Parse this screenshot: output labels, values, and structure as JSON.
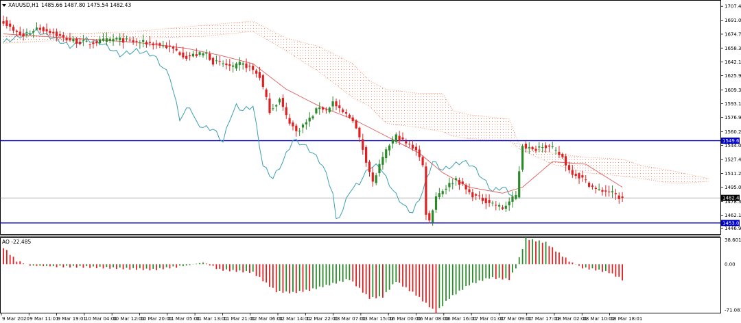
{
  "header": {
    "symbol": "XAUUSD,H1",
    "ohlc": "1485.66 1487.80 1475.54 1482.43",
    "ao_label": "AO -22.485"
  },
  "colors": {
    "bull": "#2a8a2a",
    "bear": "#e02020",
    "ma": "#e05a5a",
    "chikou": "#3a9fb0",
    "cloud": "#f08a6a",
    "level_line": "#0000cc",
    "price_line": "#808080"
  },
  "chart_data": [
    {
      "type": "candlestick",
      "title": "",
      "ylim": [
        1440,
        1714
      ],
      "y_ticks": [
        "1707.40",
        "1691.05",
        "1674.70",
        "1658.35",
        "1642.15",
        "1625.95",
        "1609.30",
        "1593.10",
        "1576.90",
        "1560.25",
        "1544.05",
        "1527.40",
        "1511.20",
        "1495.00",
        "1478.35",
        "1462.15",
        "1446.95"
      ],
      "x_ticks": [
        "9 Mar 2020",
        "9 Mar 11:01",
        "9 Mar 19:01",
        "10 Mar 04:01",
        "10 Mar 12:01",
        "10 Mar 20:01",
        "11 Mar 05:01",
        "11 Mar 13:01",
        "11 Mar 21:01",
        "12 Mar 06:01",
        "12 Mar 14:01",
        "12 Mar 22:01",
        "13 Mar 07:01",
        "13 Mar 15:01",
        "16 Mar 00:01",
        "16 Mar 08:01",
        "16 Mar 16:01",
        "17 Mar 01:01",
        "17 Mar 09:01",
        "17 Mar 17:01",
        "18 Mar 02:01",
        "18 Mar 10:01",
        "18 Mar 18:01"
      ],
      "horizontal_levels": [
        {
          "label": "1549.63",
          "value": 1549.63
        },
        {
          "label": "1453.02",
          "value": 1453.02
        }
      ],
      "current_price": {
        "label": "1482.43",
        "value": 1482.43
      },
      "anchors": [
        [
          0,
          1690
        ],
        [
          3,
          1678
        ],
        [
          6,
          1672
        ],
        [
          10,
          1682
        ],
        [
          14,
          1678
        ],
        [
          18,
          1670
        ],
        [
          22,
          1666
        ],
        [
          26,
          1664
        ],
        [
          30,
          1667
        ],
        [
          34,
          1669
        ],
        [
          38,
          1666
        ],
        [
          42,
          1665
        ],
        [
          46,
          1663
        ],
        [
          49,
          1660
        ],
        [
          52,
          1655
        ],
        [
          55,
          1648
        ],
        [
          57,
          1650
        ],
        [
          61,
          1652
        ],
        [
          63,
          1642
        ],
        [
          66,
          1640
        ],
        [
          69,
          1635
        ],
        [
          71,
          1640
        ],
        [
          74,
          1636
        ],
        [
          77,
          1625
        ],
        [
          80,
          1585
        ],
        [
          83,
          1598
        ],
        [
          85,
          1578
        ],
        [
          88,
          1560
        ],
        [
          92,
          1575
        ],
        [
          95,
          1590
        ],
        [
          97,
          1585
        ],
        [
          99,
          1595
        ],
        [
          101,
          1585
        ],
        [
          105,
          1575
        ],
        [
          108,
          1540
        ],
        [
          111,
          1500
        ],
        [
          113,
          1520
        ],
        [
          116,
          1545
        ],
        [
          118,
          1555
        ],
        [
          121,
          1546
        ],
        [
          124,
          1540
        ],
        [
          126,
          1520
        ],
        [
          127,
          1465
        ],
        [
          128,
          1455
        ],
        [
          130,
          1485
        ],
        [
          133,
          1495
        ],
        [
          136,
          1505
        ],
        [
          140,
          1488
        ],
        [
          143,
          1482
        ],
        [
          147,
          1476
        ],
        [
          150,
          1470
        ],
        [
          152,
          1478
        ],
        [
          154,
          1485
        ],
        [
          156,
          1545
        ],
        [
          159,
          1538
        ],
        [
          162,
          1545
        ],
        [
          165,
          1540
        ],
        [
          168,
          1530
        ],
        [
          170,
          1515
        ],
        [
          174,
          1505
        ],
        [
          178,
          1492
        ],
        [
          182,
          1490
        ],
        [
          185,
          1483
        ],
        [
          186,
          1482.43
        ]
      ],
      "ma_anchors": [
        [
          0,
          1675
        ],
        [
          20,
          1670
        ],
        [
          40,
          1665
        ],
        [
          55,
          1658
        ],
        [
          65,
          1650
        ],
        [
          75,
          1640
        ],
        [
          85,
          1610
        ],
        [
          95,
          1590
        ],
        [
          105,
          1575
        ],
        [
          115,
          1555
        ],
        [
          125,
          1535
        ],
        [
          132,
          1512
        ],
        [
          140,
          1495
        ],
        [
          150,
          1488
        ],
        [
          156,
          1495
        ],
        [
          165,
          1525
        ],
        [
          175,
          1522
        ],
        [
          186,
          1495
        ]
      ],
      "chikou_anchors": [
        [
          0,
          1665
        ],
        [
          5,
          1672
        ],
        [
          10,
          1678
        ],
        [
          15,
          1670
        ],
        [
          20,
          1660
        ],
        [
          25,
          1668
        ],
        [
          30,
          1663
        ],
        [
          35,
          1650
        ],
        [
          40,
          1655
        ],
        [
          45,
          1650
        ],
        [
          50,
          1625
        ],
        [
          53,
          1575
        ],
        [
          56,
          1590
        ],
        [
          58,
          1570
        ],
        [
          60,
          1565
        ],
        [
          63,
          1563
        ],
        [
          66,
          1548
        ],
        [
          68,
          1575
        ],
        [
          70,
          1590
        ],
        [
          72,
          1585
        ],
        [
          75,
          1590
        ],
        [
          78,
          1520
        ],
        [
          81,
          1505
        ],
        [
          84,
          1525
        ],
        [
          87,
          1550
        ],
        [
          90,
          1545
        ],
        [
          93,
          1535
        ],
        [
          96,
          1520
        ],
        [
          99,
          1488
        ],
        [
          100,
          1455
        ],
        [
          102,
          1468
        ],
        [
          104,
          1490
        ],
        [
          107,
          1500
        ],
        [
          110,
          1518
        ],
        [
          113,
          1520
        ],
        [
          115,
          1505
        ],
        [
          118,
          1485
        ],
        [
          121,
          1470
        ],
        [
          123,
          1465
        ],
        [
          126,
          1490
        ],
        [
          129,
          1525
        ],
        [
          132,
          1515
        ],
        [
          135,
          1520
        ],
        [
          138,
          1525
        ],
        [
          141,
          1520
        ],
        [
          144,
          1505
        ],
        [
          147,
          1490
        ],
        [
          150,
          1495
        ],
        [
          153,
          1485
        ]
      ],
      "cloud_top": [
        [
          0,
          1672
        ],
        [
          20,
          1675
        ],
        [
          40,
          1678
        ],
        [
          60,
          1685
        ],
        [
          75,
          1690
        ],
        [
          85,
          1670
        ],
        [
          95,
          1660
        ],
        [
          105,
          1640
        ],
        [
          110,
          1620
        ],
        [
          115,
          1610
        ],
        [
          125,
          1605
        ],
        [
          132,
          1605
        ],
        [
          135,
          1585
        ],
        [
          140,
          1580
        ],
        [
          152,
          1575
        ],
        [
          155,
          1545
        ],
        [
          165,
          1535
        ],
        [
          175,
          1530
        ],
        [
          186,
          1528
        ],
        [
          192,
          1520
        ],
        [
          200,
          1515
        ],
        [
          206,
          1510
        ],
        [
          212,
          1505
        ]
      ],
      "cloud_bottom": [
        [
          0,
          1664
        ],
        [
          20,
          1668
        ],
        [
          40,
          1670
        ],
        [
          60,
          1672
        ],
        [
          75,
          1678
        ],
        [
          85,
          1655
        ],
        [
          95,
          1630
        ],
        [
          105,
          1600
        ],
        [
          110,
          1590
        ],
        [
          115,
          1570
        ],
        [
          125,
          1565
        ],
        [
          132,
          1560
        ],
        [
          135,
          1555
        ],
        [
          140,
          1552
        ],
        [
          152,
          1550
        ],
        [
          155,
          1540
        ],
        [
          165,
          1522
        ],
        [
          175,
          1512
        ],
        [
          186,
          1508
        ],
        [
          192,
          1505
        ],
        [
          200,
          1500
        ],
        [
          206,
          1500
        ],
        [
          212,
          1502
        ]
      ]
    },
    {
      "type": "bar",
      "title": "",
      "ylim": [
        -71.5,
        38.6
      ],
      "y_ticks": [
        "38.601",
        "0.00",
        "-71.081"
      ],
      "anchors": [
        [
          0,
          25
        ],
        [
          4,
          5
        ],
        [
          8,
          -2
        ],
        [
          15,
          -3
        ],
        [
          25,
          -4
        ],
        [
          35,
          -6
        ],
        [
          45,
          -8
        ],
        [
          55,
          -2
        ],
        [
          60,
          3
        ],
        [
          65,
          -8
        ],
        [
          75,
          -12
        ],
        [
          82,
          -40
        ],
        [
          87,
          -42
        ],
        [
          92,
          -38
        ],
        [
          98,
          -30
        ],
        [
          104,
          -22
        ],
        [
          110,
          -50
        ],
        [
          114,
          -48
        ],
        [
          118,
          -25
        ],
        [
          124,
          -45
        ],
        [
          130,
          -71
        ],
        [
          134,
          -50
        ],
        [
          140,
          -30
        ],
        [
          146,
          -20
        ],
        [
          152,
          -22
        ],
        [
          154,
          -5
        ],
        [
          157,
          38
        ],
        [
          163,
          32
        ],
        [
          166,
          20
        ],
        [
          170,
          5
        ],
        [
          174,
          -5
        ],
        [
          178,
          -8
        ],
        [
          182,
          -12
        ],
        [
          186,
          -22.485
        ]
      ]
    }
  ]
}
